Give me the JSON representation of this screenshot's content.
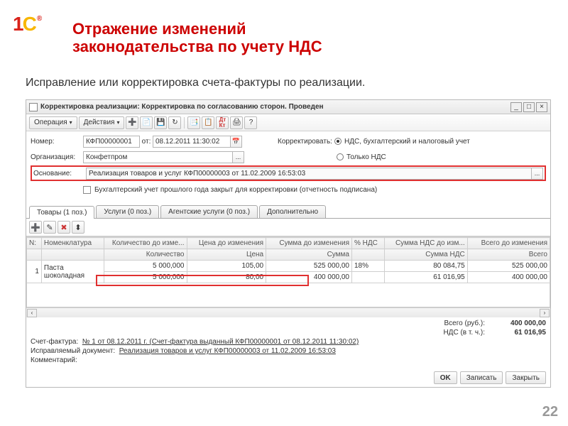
{
  "page": {
    "title_line1": "Отражение изменений",
    "title_line2": "законодательства по учету НДС",
    "subtitle": "Исправление или корректировка счета-фактуры по реализации.",
    "page_number": "22"
  },
  "window": {
    "title": "Корректировка реализации: Корректировка по согласованию сторон. Проведен"
  },
  "toolbar": {
    "operation": "Операция",
    "actions": "Действия"
  },
  "form": {
    "nomer_label": "Номер:",
    "nomer_value": "КФП00000001",
    "ot_label": "от:",
    "ot_value": "08.12.2011 11:30:02",
    "korr_label": "Корректировать:",
    "radio_full": "НДС, бухгалтерский и налоговый учет",
    "radio_only": "Только НДС",
    "org_label": "Организация:",
    "org_value": "Конфетпром",
    "osn_label": "Основание:",
    "osn_value": "Реализация товаров и услуг КФП00000003 от 11.02.2009 16:53:03",
    "closed_year": "Бухгалтерский учет прошлого года закрыт для корректировки (отчетность подписана)"
  },
  "tabs": {
    "t1": "Товары (1 поз.)",
    "t2": "Услуги (0 поз.)",
    "t3": "Агентские услуги (0 поз.)",
    "t4": "Дополнительно"
  },
  "grid": {
    "cols1": {
      "n": "N:",
      "nomen": "Номенклатура",
      "qty_b": "Количество до изме...",
      "price_b": "Цена до изменения",
      "sum_b": "Сумма до изменения",
      "vat": "% НДС",
      "vat_sum_b": "Сумма НДС до изм...",
      "total_b": "Всего до изменения"
    },
    "cols2": {
      "qty": "Количество",
      "price": "Цена",
      "sum": "Сумма",
      "vat_sum": "Сумма НДС",
      "total": "Всего"
    },
    "row": {
      "n": "1",
      "nomen": "Паста шоколадная",
      "qty_b": "5 000,000",
      "price_b": "105,00",
      "sum_b": "525 000,00",
      "vat": "18%",
      "vat_sum_b": "80 084,75",
      "total_b": "525 000,00",
      "qty": "5 000,000",
      "price": "80,00",
      "sum": "400 000,00",
      "vat_sum": "61 016,95",
      "total": "400 000,00"
    }
  },
  "footer": {
    "total_label": "Всего (руб.):",
    "total_value": "400 000,00",
    "vat_label": "НДС (в т. ч.):",
    "vat_value": "61 016,95",
    "sf_label": "Счет-фактура:",
    "sf_link": "№ 1 от 08.12.2011 г. (Счет-фактура выданный КФП00000001 от 08.12.2011 11:30:02)",
    "isp_label": "Исправляемый документ:",
    "isp_link": "Реализация товаров и услуг КФП00000003 от 11.02.2009 16:53:03",
    "comm_label": "Комментарий:"
  },
  "buttons": {
    "ok": "OK",
    "save": "Записать",
    "close": "Закрыть"
  }
}
